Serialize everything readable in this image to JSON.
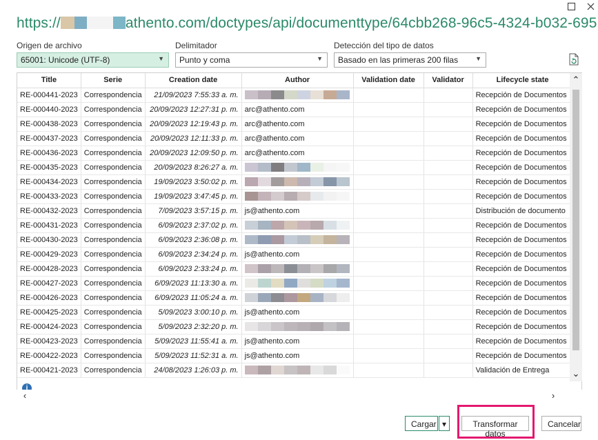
{
  "window": {
    "maximize_label": "□",
    "close_label": "✕"
  },
  "url_title": {
    "prefix": "https://",
    "suffix": "athento.com/doctypes/api/documenttype/64cbb268-96c5-4324-b032-695..."
  },
  "file_origin": {
    "label": "Origen de archivo",
    "value": "65001: Unicode (UTF-8)"
  },
  "delimiter": {
    "label": "Delimitador",
    "value": "Punto y coma"
  },
  "type_detection": {
    "label": "Detección del tipo de datos",
    "value": "Basado en las primeras 200 filas"
  },
  "table": {
    "columns": [
      "Title",
      "Serie",
      "Creation date",
      "Author",
      "Validation date",
      "Validator",
      "Lifecycle state"
    ],
    "rows": [
      {
        "title": "RE-000441-2023",
        "serie": "Correspondencia",
        "date": "21/09/2023 7:55:33 a. m.",
        "author": "",
        "lifecycle": "Recepción de Documentos"
      },
      {
        "title": "RE-000440-2023",
        "serie": "Correspondencia",
        "date": "20/09/2023 12:27:31 p. m.",
        "author": "arc@athento.com",
        "lifecycle": "Recepción de Documentos"
      },
      {
        "title": "RE-000438-2023",
        "serie": "Correspondencia",
        "date": "20/09/2023 12:19:43 p. m.",
        "author": "arc@athento.com",
        "lifecycle": "Recepción de Documentos"
      },
      {
        "title": "RE-000437-2023",
        "serie": "Correspondencia",
        "date": "20/09/2023 12:11:33 p. m.",
        "author": "arc@athento.com",
        "lifecycle": "Recepción de Documentos"
      },
      {
        "title": "RE-000436-2023",
        "serie": "Correspondencia",
        "date": "20/09/2023 12:09:50 p. m.",
        "author": "arc@athento.com",
        "lifecycle": "Recepción de Documentos"
      },
      {
        "title": "RE-000435-2023",
        "serie": "Correspondencia",
        "date": "20/09/2023 8:26:27 a. m.",
        "author": "",
        "lifecycle": "Recepción de Documentos"
      },
      {
        "title": "RE-000434-2023",
        "serie": "Correspondencia",
        "date": "19/09/2023 3:50:02 p. m.",
        "author": "",
        "lifecycle": "Recepción de Documentos"
      },
      {
        "title": "RE-000433-2023",
        "serie": "Correspondencia",
        "date": "19/09/2023 3:47:45 p. m.",
        "author": "",
        "lifecycle": "Recepción de Documentos"
      },
      {
        "title": "RE-000432-2023",
        "serie": "Correspondencia",
        "date": "7/09/2023 3:57:15 p. m.",
        "author": "js@athento.com",
        "lifecycle": "Distribución de documento"
      },
      {
        "title": "RE-000431-2023",
        "serie": "Correspondencia",
        "date": "6/09/2023 2:37:02 p. m.",
        "author": "",
        "lifecycle": "Recepción de Documentos"
      },
      {
        "title": "RE-000430-2023",
        "serie": "Correspondencia",
        "date": "6/09/2023 2:36:08 p. m.",
        "author": "",
        "lifecycle": "Recepción de Documentos"
      },
      {
        "title": "RE-000429-2023",
        "serie": "Correspondencia",
        "date": "6/09/2023 2:34:24 p. m.",
        "author": "js@athento.com",
        "lifecycle": "Recepción de Documentos"
      },
      {
        "title": "RE-000428-2023",
        "serie": "Correspondencia",
        "date": "6/09/2023 2:33:24 p. m.",
        "author": "",
        "lifecycle": "Recepción de Documentos"
      },
      {
        "title": "RE-000427-2023",
        "serie": "Correspondencia",
        "date": "6/09/2023 11:13:30 a. m.",
        "author": "",
        "lifecycle": "Recepción de Documentos"
      },
      {
        "title": "RE-000426-2023",
        "serie": "Correspondencia",
        "date": "6/09/2023 11:05:24 a. m.",
        "author": "",
        "lifecycle": "Recepción de Documentos"
      },
      {
        "title": "RE-000425-2023",
        "serie": "Correspondencia",
        "date": "5/09/2023 3:00:10 p. m.",
        "author": "js@athento.com",
        "lifecycle": "Recepción de Documentos"
      },
      {
        "title": "RE-000424-2023",
        "serie": "Correspondencia",
        "date": "5/09/2023 2:32:20 p. m.",
        "author": "",
        "lifecycle": "Recepción de Documentos"
      },
      {
        "title": "RE-000423-2023",
        "serie": "Correspondencia",
        "date": "5/09/2023 11:55:41 a. m.",
        "author": "js@athento.com",
        "lifecycle": "Recepción de Documentos"
      },
      {
        "title": "RE-000422-2023",
        "serie": "Correspondencia",
        "date": "5/09/2023 11:52:31 a. m.",
        "author": "js@athento.com",
        "lifecycle": "Recepción de Documentos"
      },
      {
        "title": "RE-000421-2023",
        "serie": "Correspondencia",
        "date": "24/08/2023 1:26:03 p. m.",
        "author": "",
        "lifecycle": "Validación de Entrega"
      }
    ]
  },
  "buttons": {
    "load": "Cargar",
    "load_more": "▾",
    "transform": "Transformar datos",
    "cancel": "Cancelar"
  },
  "colors": {
    "url": "#2b8a68",
    "selected_dropdown": "#d6efe3",
    "highlight": "#e3186e",
    "primary_border": "#2b8a68"
  }
}
